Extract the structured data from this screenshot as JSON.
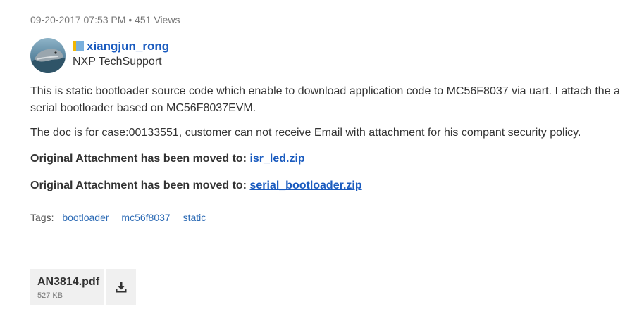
{
  "post": {
    "meta": "09-20-2017 07:53 PM • 451 Views"
  },
  "author": {
    "name": "xiangjun_rong",
    "rank": "NXP TechSupport"
  },
  "content": {
    "paragraph_1": "This is static bootloader source code which enable to download application code to MC56F8037 via uart. I attach the  a serial bootloader based on MC56F8037EVM.",
    "paragraph_2": "The doc is for case:00133551, customer can not receive Email with attachment for his compant security policy.",
    "moved_label_1": "Original Attachment has been moved to: ",
    "moved_link_1": "isr_led.zip",
    "moved_label_2": "Original Attachment has been moved to: ",
    "moved_link_2": "serial_bootloader.zip"
  },
  "tags": {
    "label": "Tags:",
    "items": [
      "bootloader",
      "mc56f8037",
      "static"
    ]
  },
  "attachment": {
    "name": "AN3814.pdf",
    "size": "527 KB",
    "download_icon": "download-icon"
  },
  "colors": {
    "link": "#1a5bbf",
    "meta_text": "#777777",
    "attachment_bg": "#f0f0f0"
  }
}
